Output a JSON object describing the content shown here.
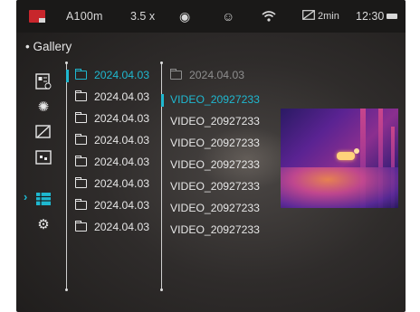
{
  "status_bar": {
    "range": "A100m",
    "zoom": "3.5 x",
    "low_power_label": "2min",
    "time": "12:30",
    "icons": [
      "record-icon",
      "eye-icon",
      "face-detect-icon",
      "wifi-icon",
      "low-power-icon",
      "battery-icon"
    ],
    "accent_color": "#c8262c"
  },
  "gallery": {
    "title": "Gallery",
    "title_bullet": "•"
  },
  "sidebar": {
    "icons": [
      "image-settings-icon",
      "brightness-icon",
      "calibration-icon",
      "picture-in-picture-icon",
      "gallery-grid-icon",
      "settings-gear-icon"
    ],
    "active": "gallery-grid-icon",
    "selected_indicator": "›"
  },
  "folders": {
    "items": [
      "2024.04.03",
      "2024.04.03",
      "2024.04.03",
      "2024.04.03",
      "2024.04.03",
      "2024.04.03",
      "2024.04.03",
      "2024.04.03"
    ],
    "active_index": 0
  },
  "files": {
    "header": "2024.04.03",
    "items": [
      "VIDEO_20927233",
      "VIDEO_20927233",
      "VIDEO_20927233",
      "VIDEO_20927233",
      "VIDEO_20927233",
      "VIDEO_20927233",
      "VIDEO_20927233"
    ],
    "active_index": 0
  },
  "colors": {
    "accent": "#1fb8d0",
    "text": "#e6e6e6",
    "muted": "#8e8e8e"
  }
}
